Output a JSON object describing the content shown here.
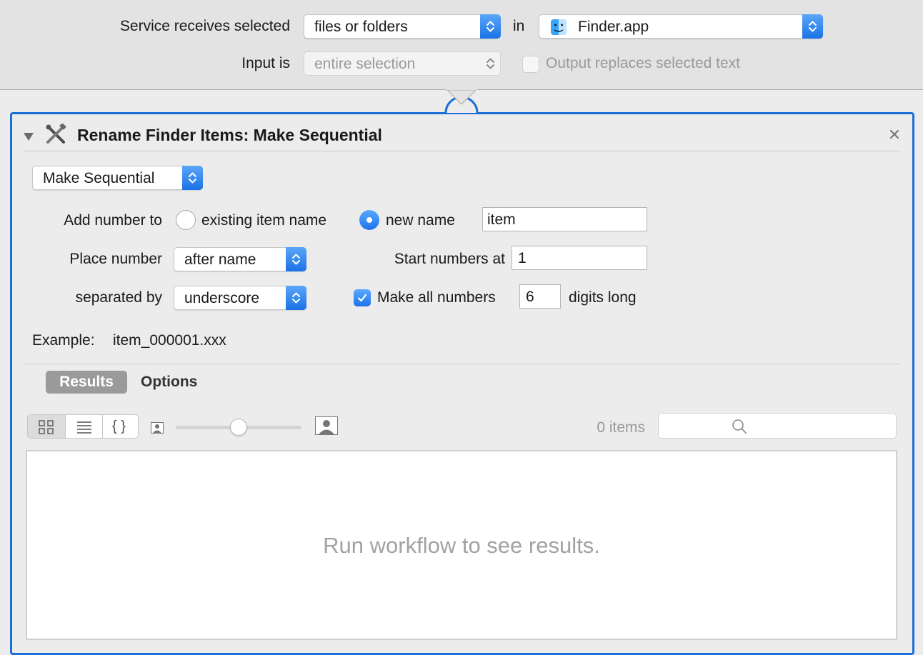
{
  "service_header": {
    "receives_label": "Service receives selected",
    "receives_value": "files or folders",
    "in_label": "in",
    "app_value": "Finder.app",
    "input_label": "Input is",
    "input_value": "entire selection",
    "output_replaces_label": "Output replaces selected text",
    "output_replaces_checked": false
  },
  "action": {
    "title": "Rename Finder Items: Make Sequential",
    "mode_value": "Make Sequential",
    "add_number_label": "Add number to",
    "option_existing": "existing item name",
    "option_new": "new name",
    "selected_option": "new name",
    "new_name_value": "item",
    "place_number_label": "Place number",
    "place_number_value": "after name",
    "start_numbers_label": "Start numbers at",
    "start_numbers_value": "1",
    "separated_by_label": "separated by",
    "separated_by_value": "underscore",
    "make_all_label": "Make all numbers",
    "make_all_checked": true,
    "digits_value": "6",
    "digits_long_label": "digits long",
    "example_label": "Example:",
    "example_value": "item_000001.xxx"
  },
  "tabs": {
    "results": "Results",
    "options": "Options",
    "active": "Results"
  },
  "results": {
    "view_modes": [
      "icon-view",
      "list-view",
      "json-view"
    ],
    "active_view": "icon-view",
    "item_count": "0 items",
    "empty_message": "Run workflow to see results.",
    "zoom_level": 0.42
  },
  "colors": {
    "accent": "#1c6fd6",
    "header_bg": "#e3e3e3",
    "panel_bg": "#ececec"
  },
  "icons": [
    "stepper-icon",
    "finder-icon",
    "disclosure-triangle-icon",
    "tools-icon",
    "close-icon",
    "grid-view-icon",
    "list-view-icon",
    "braces-icon",
    "small-person-icon",
    "large-person-icon",
    "search-icon",
    "checkmark-icon"
  ]
}
